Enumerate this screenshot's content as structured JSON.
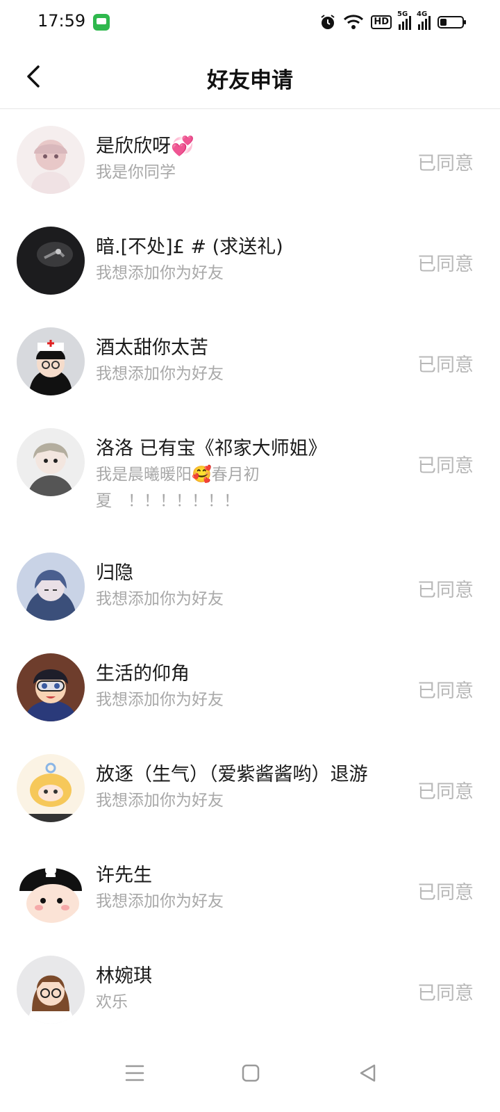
{
  "status_bar": {
    "time": "17:59",
    "hd_badge": "HD",
    "signal1_label": "5G",
    "signal2_label": "4G",
    "battery_level": 0.3
  },
  "header": {
    "title": "好友申请"
  },
  "requests": [
    {
      "name": "是欣欣呀💞",
      "message": "我是你同学",
      "status": "已同意"
    },
    {
      "name": "暗.[不处]£ # (求送礼)",
      "message": "我想添加你为好友",
      "status": "已同意"
    },
    {
      "name": "酒太甜你太苦",
      "message": "我想添加你为好友",
      "status": "已同意"
    },
    {
      "name": "洛洛 已有宝《祁家大师姐》",
      "message_line1": "我是晨曦暖阳🥰春月初",
      "message_line2": "夏　！！！！！！！",
      "status": "已同意"
    },
    {
      "name": "归隐",
      "message": "我想添加你为好友",
      "status": "已同意"
    },
    {
      "name": "生活的仰角",
      "message": "我想添加你为好友",
      "status": "已同意"
    },
    {
      "name": "放逐（生气）（爱紫酱酱哟）退游",
      "message": "我想添加你为好友",
      "status": "已同意"
    },
    {
      "name": "许先生",
      "message": "我想添加你为好友",
      "status": "已同意"
    },
    {
      "name": "林婉琪",
      "message": "欢乐",
      "status": "已同意"
    }
  ]
}
